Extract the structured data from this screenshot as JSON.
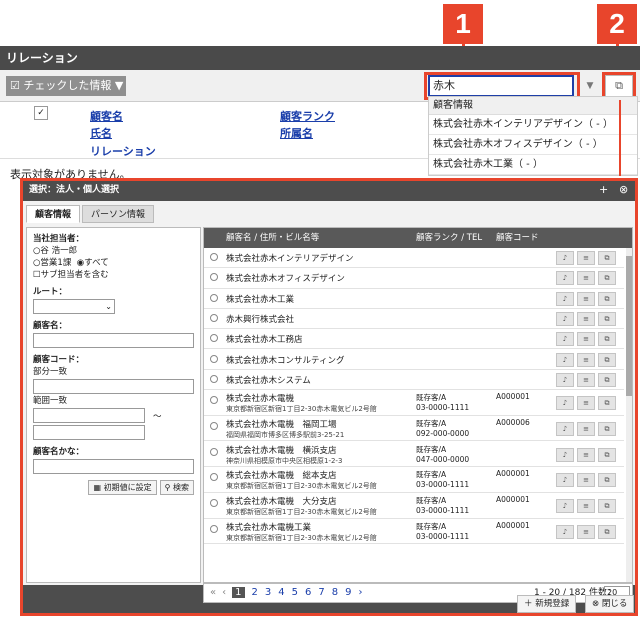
{
  "callouts": {
    "one": "1",
    "two": "2"
  },
  "main": {
    "title": "リレーション",
    "checked_info_button": "チェックした情報",
    "search_value": "赤木",
    "columns": {
      "customer_name": "顧客名",
      "customer_rank": "顧客ランク",
      "name": "氏名",
      "department": "所属名",
      "relation": "リレーション"
    },
    "empty_message": "表示対象がありません。"
  },
  "suggest": {
    "header": "顧客情報",
    "items": [
      "株式会社赤木インテリアデザイン（ - ）",
      "株式会社赤木オフィスデザイン（ - ）",
      "株式会社赤木工業（ - ）"
    ]
  },
  "modal": {
    "title": "選択：法人・個人選択",
    "tabs": [
      "顧客情報",
      "パーソン情報"
    ],
    "filter": {
      "owner_label": "当社担当者：",
      "owner_option1": "谷 浩一郎",
      "owner_option2": "営業1課",
      "owner_option3": "すべて",
      "sub_owner": "サブ担当者を含む",
      "route_label": "ルート：",
      "customer_name_label": "顧客名：",
      "code_label": "顧客コード：",
      "partial_match": "部分一致",
      "range_match": "範囲一致",
      "tilde": "〜",
      "kana_label": "顧客名かな：",
      "reset_button": "初期値に設定",
      "search_button": "検索"
    },
    "table": {
      "headers": {
        "name": "顧客名 / 住所・ビル名等",
        "rank": "顧客ランク / TEL",
        "code": "顧客コード"
      },
      "rows": [
        {
          "name": "株式会社赤木インテリアデザイン",
          "address": "",
          "rank": "",
          "tel": "",
          "code": ""
        },
        {
          "name": "株式会社赤木オフィスデザイン",
          "address": "",
          "rank": "",
          "tel": "",
          "code": ""
        },
        {
          "name": "株式会社赤木工業",
          "address": "",
          "rank": "",
          "tel": "",
          "code": ""
        },
        {
          "name": "赤木興行株式会社",
          "address": "",
          "rank": "",
          "tel": "",
          "code": ""
        },
        {
          "name": "株式会社赤木工務店",
          "address": "",
          "rank": "",
          "tel": "",
          "code": ""
        },
        {
          "name": "株式会社赤木コンサルティング",
          "address": "",
          "rank": "",
          "tel": "",
          "code": ""
        },
        {
          "name": "株式会社赤木システム",
          "address": "",
          "rank": "",
          "tel": "",
          "code": ""
        },
        {
          "name": "株式会社赤木電機",
          "address": "東京都新宿区新宿1丁目2-30赤木電気ビル2号館",
          "rank": "既存客/A",
          "tel": "03-0000-1111",
          "code": "A000001"
        },
        {
          "name": "株式会社赤木電機　福岡工場",
          "address": "福岡県福岡市博多区博多駅前3-25-21",
          "rank": "既存客/A",
          "tel": "092-000-0000",
          "code": "A000006"
        },
        {
          "name": "株式会社赤木電機　横浜支店",
          "address": "神奈川県相模原市中央区相模原1-2-3",
          "rank": "既存客/A",
          "tel": "047-000-0000",
          "code": ""
        },
        {
          "name": "株式会社赤木電機　総本支店",
          "address": "東京都新宿区新宿1丁目2-30赤木電気ビル2号館",
          "rank": "既存客/A",
          "tel": "03-0000-1111",
          "code": "A000001"
        },
        {
          "name": "株式会社赤木電機　大分支店",
          "address": "東京都新宿区新宿1丁目2-30赤木電気ビル2号館",
          "rank": "既存客/A",
          "tel": "03-0000-1111",
          "code": "A000001"
        },
        {
          "name": "株式会社赤木電機工業",
          "address": "東京都新宿区新宿1丁目2-30赤木電気ビル2号館",
          "rank": "既存客/A",
          "tel": "03-0000-1111",
          "code": "A000001"
        }
      ]
    },
    "pager": {
      "first": "«",
      "prev": "‹",
      "pages": [
        "1",
        "2",
        "3",
        "4",
        "5",
        "6",
        "7",
        "8",
        "9"
      ],
      "next": "›",
      "summary": "1 - 20 / 182 件数：",
      "per_page": "20"
    },
    "footer": {
      "new_button": "新規登録",
      "close_button": "閉じる"
    }
  }
}
